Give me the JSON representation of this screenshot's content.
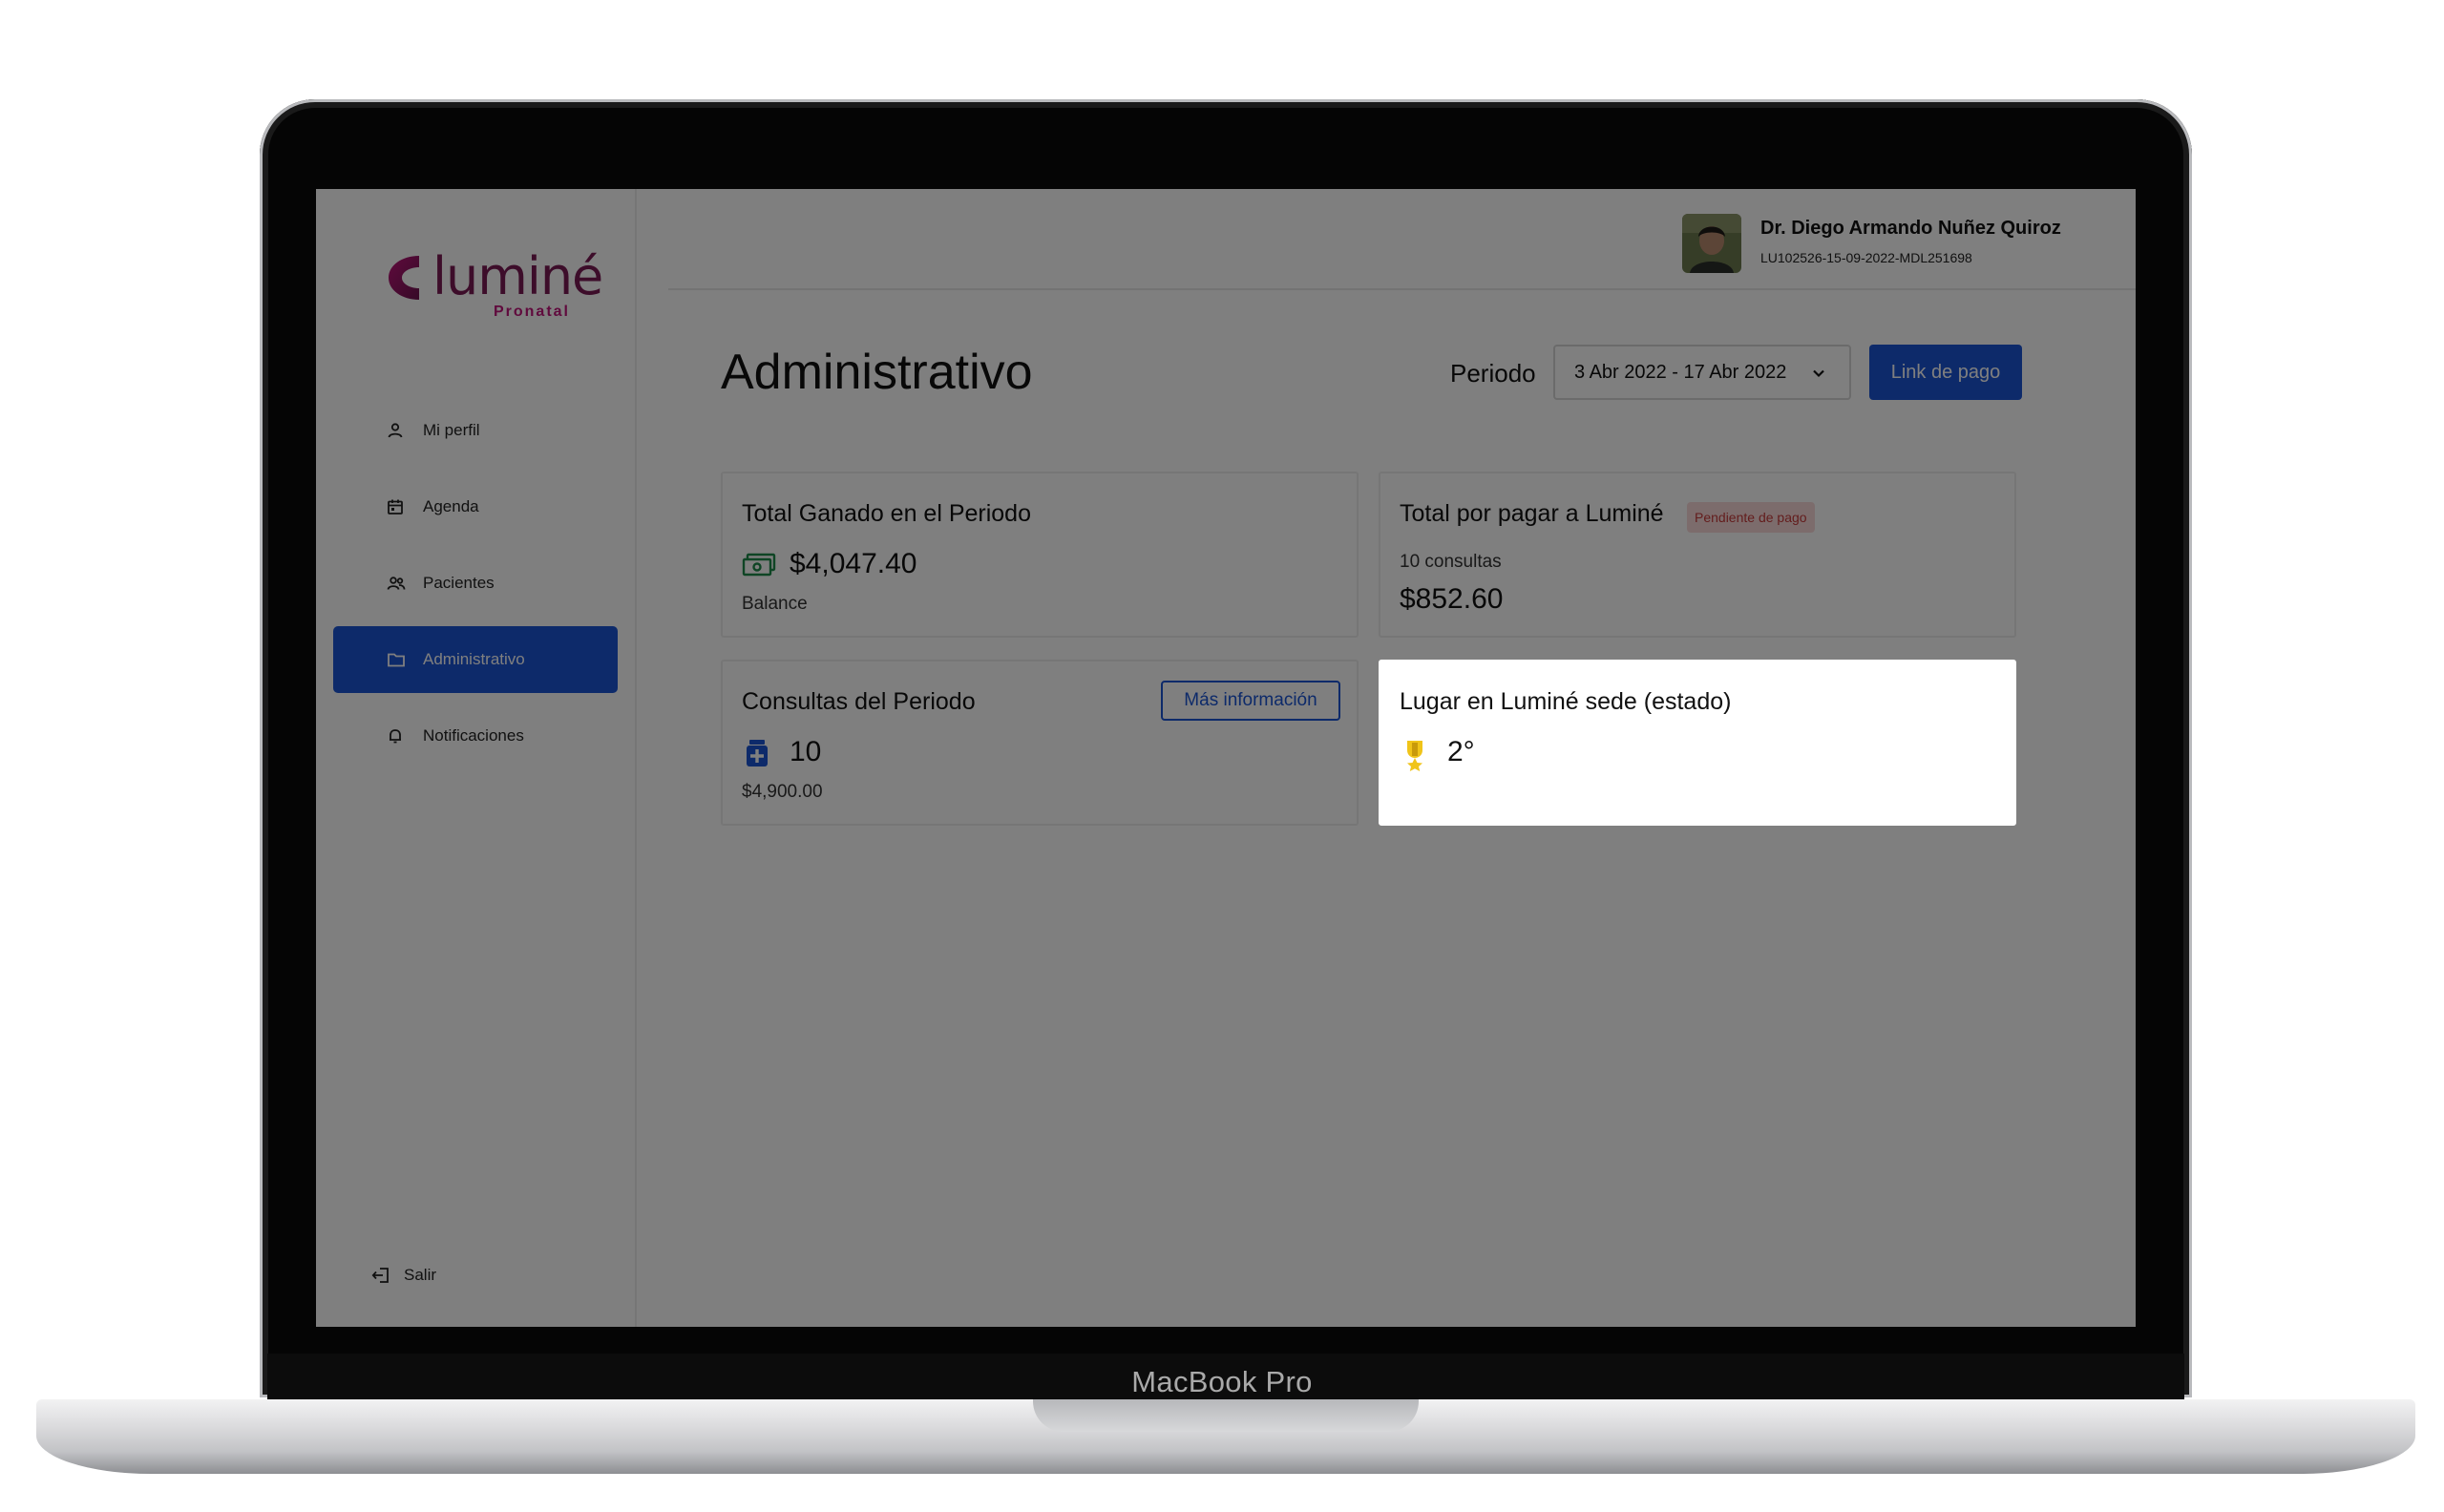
{
  "device": {
    "label": "MacBook Pro"
  },
  "brand": {
    "name": "luminé",
    "sub": "Pronatal",
    "colors": {
      "primary": "#1a55d4",
      "logo": "#7a1a55",
      "logo_accent": "#c0157a"
    }
  },
  "sidebar": {
    "items": [
      {
        "label": "Mi perfil",
        "icon": "user-icon"
      },
      {
        "label": "Agenda",
        "icon": "calendar-icon"
      },
      {
        "label": "Pacientes",
        "icon": "users-icon"
      },
      {
        "label": "Administrativo",
        "icon": "folder-icon",
        "active": true
      },
      {
        "label": "Notificaciones",
        "icon": "bell-icon"
      }
    ],
    "logout": {
      "label": "Salir",
      "icon": "logout-icon"
    }
  },
  "user": {
    "name": "Dr. Diego Armando Nuñez Quiroz",
    "id": "LU102526-15-09-2022-MDL251698"
  },
  "page": {
    "title": "Administrativo",
    "period_label": "Periodo",
    "period_value": "3 Abr 2022 - 17 Abr 2022",
    "pay_link": "Link de pago"
  },
  "cards": {
    "earned": {
      "title": "Total Ganado en el Periodo",
      "value": "$4,047.40",
      "sub": "Balance",
      "icon": "money-icon"
    },
    "to_pay": {
      "title": "Total por pagar a Luminé",
      "badge": "Pendiente de pago",
      "count": "10 consultas",
      "value": "$852.60"
    },
    "consults": {
      "title": "Consultas del Periodo",
      "button": "Más información",
      "value": "10",
      "sub": "$4,900.00",
      "icon": "medicine-icon"
    },
    "ranking": {
      "title": "Lugar en Luminé sede (estado)",
      "value": "2°",
      "icon": "trophy-icon"
    }
  }
}
